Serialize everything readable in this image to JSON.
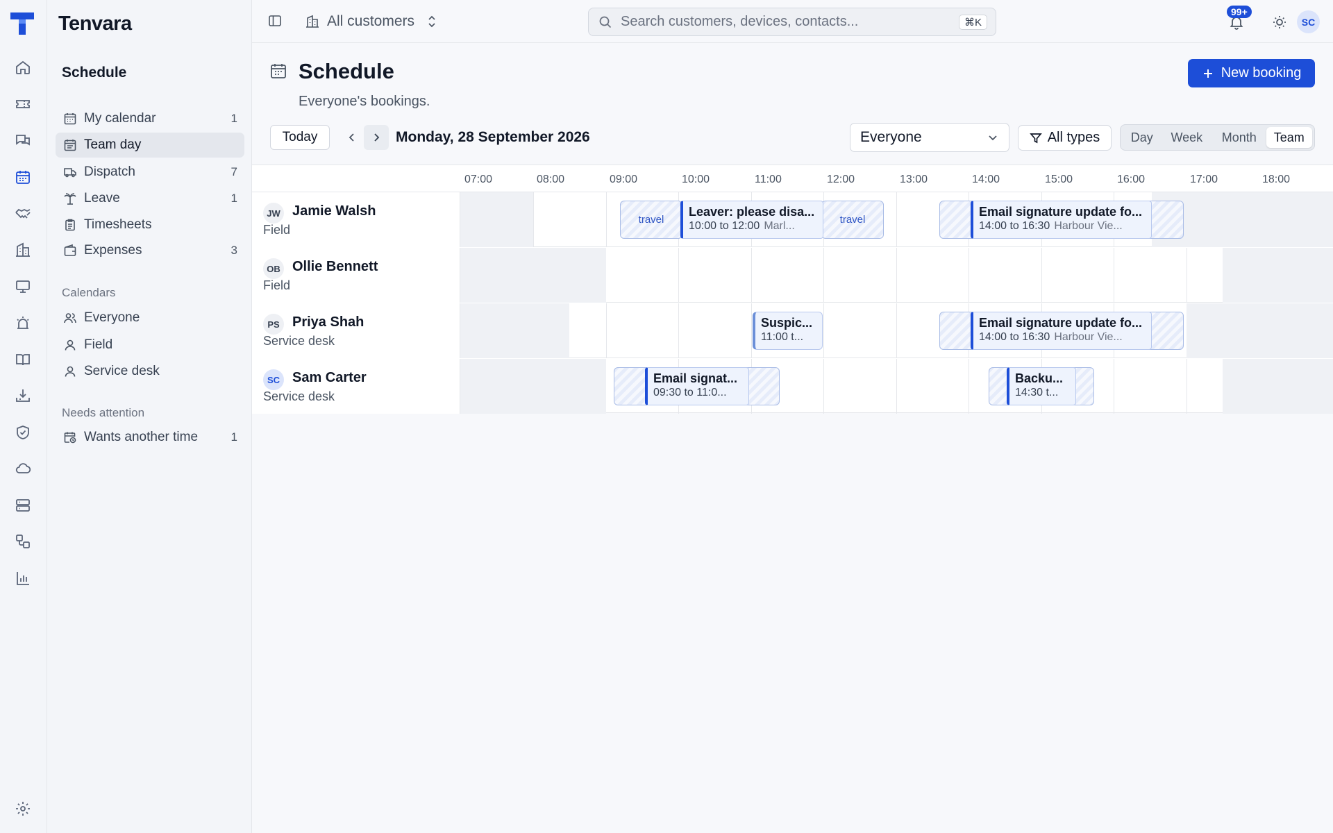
{
  "app": {
    "brand": "Tenvara"
  },
  "topbar": {
    "customer_scope": "All customers",
    "search_placeholder": "Search customers, devices, contacts...",
    "search_shortcut": "⌘K",
    "notifications_badge": "99+",
    "user_initials": "SC"
  },
  "sidebar": {
    "title": "Schedule",
    "items": [
      {
        "label": "My calendar",
        "count": "1",
        "icon": "calendar-icon"
      },
      {
        "label": "Team day",
        "count": "",
        "icon": "calendar-list-icon"
      },
      {
        "label": "Dispatch",
        "count": "7",
        "icon": "truck-icon"
      },
      {
        "label": "Leave",
        "count": "1",
        "icon": "palm-tree-icon"
      },
      {
        "label": "Timesheets",
        "count": "",
        "icon": "clipboard-icon"
      },
      {
        "label": "Expenses",
        "count": "3",
        "icon": "wallet-icon"
      }
    ],
    "calendars_heading": "Calendars",
    "calendars": [
      {
        "label": "Everyone",
        "icon": "users-icon"
      },
      {
        "label": "Field",
        "icon": "user-icon"
      },
      {
        "label": "Service desk",
        "icon": "user-icon"
      }
    ],
    "attention_heading": "Needs attention",
    "attention": [
      {
        "label": "Wants another time",
        "count": "1",
        "icon": "calendar-clock-icon"
      }
    ]
  },
  "page": {
    "title": "Schedule",
    "subtitle": "Everyone's bookings.",
    "new_booking": "New booking"
  },
  "toolbar": {
    "today": "Today",
    "date": "Monday, 28 September 2026",
    "people_filter": "Everyone",
    "types_filter": "All types",
    "views": [
      "Day",
      "Week",
      "Month",
      "Team"
    ],
    "active_view": "Team"
  },
  "timeline": {
    "hours": [
      "07:00",
      "08:00",
      "09:00",
      "10:00",
      "11:00",
      "12:00",
      "13:00",
      "14:00",
      "15:00",
      "16:00",
      "17:00",
      "18:00"
    ],
    "travel_label": "travel",
    "people": [
      {
        "initials": "JW",
        "name": "Jamie Walsh",
        "role": "Field",
        "bookings": [
          {
            "title": "Leaver: please disa...",
            "time": "10:00 to 12:00",
            "location": "Marl..."
          },
          {
            "title": "Email signature update fo...",
            "time": "14:00 to 16:30",
            "location": "Harbour Vie..."
          }
        ]
      },
      {
        "initials": "OB",
        "name": "Ollie Bennett",
        "role": "Field",
        "bookings": []
      },
      {
        "initials": "PS",
        "name": "Priya Shah",
        "role": "Service desk",
        "bookings": [
          {
            "title": "Suspic...",
            "time": "11:00 t...",
            "location": ""
          },
          {
            "title": "Email signature update fo...",
            "time": "14:00 to 16:30",
            "location": "Harbour Vie..."
          }
        ]
      },
      {
        "initials": "SC",
        "name": "Sam Carter",
        "role": "Service desk",
        "bookings": [
          {
            "title": "Email signat...",
            "time": "09:30 to 11:0...",
            "location": ""
          },
          {
            "title": "Backu...",
            "time": "14:30 t...",
            "location": ""
          }
        ]
      }
    ]
  }
}
